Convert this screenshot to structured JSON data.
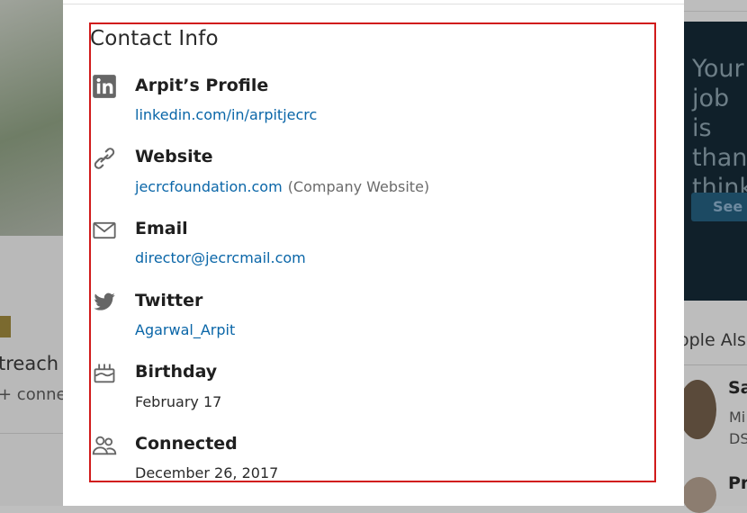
{
  "background_left": {
    "text_1": "treach a",
    "text_2": "+ conne"
  },
  "background_right": {
    "ad_text_lines": [
      "Your",
      "job is",
      "than",
      "think"
    ],
    "ad_button": "See j",
    "section_title": "ople Also",
    "person_1_name": "Sa",
    "person_1_sub_1": "Mi",
    "person_1_sub_2": "DS",
    "person_2_name": "Pr"
  },
  "contact_info": {
    "title": "Contact Info",
    "items": [
      {
        "icon": "linkedin-icon",
        "label": "Arpit’s Profile",
        "value": "linkedin.com/in/arpitjecrc",
        "type": "link"
      },
      {
        "icon": "link-icon",
        "label": "Website",
        "value": "jecrcfoundation.com",
        "note": "(Company Website)",
        "type": "link"
      },
      {
        "icon": "envelope-icon",
        "label": "Email",
        "value": "director@jecrcmail.com",
        "type": "link"
      },
      {
        "icon": "twitter-icon",
        "label": "Twitter",
        "value": "Agarwal_Arpit",
        "type": "link"
      },
      {
        "icon": "birthday-cake-icon",
        "label": "Birthday",
        "value": "February 17",
        "type": "text"
      },
      {
        "icon": "people-icon",
        "label": "Connected",
        "value": "December 26, 2017",
        "type": "text"
      }
    ]
  },
  "colors": {
    "link": "#0a66a8",
    "highlight_border": "#d11b1b",
    "icon": "#666666"
  }
}
